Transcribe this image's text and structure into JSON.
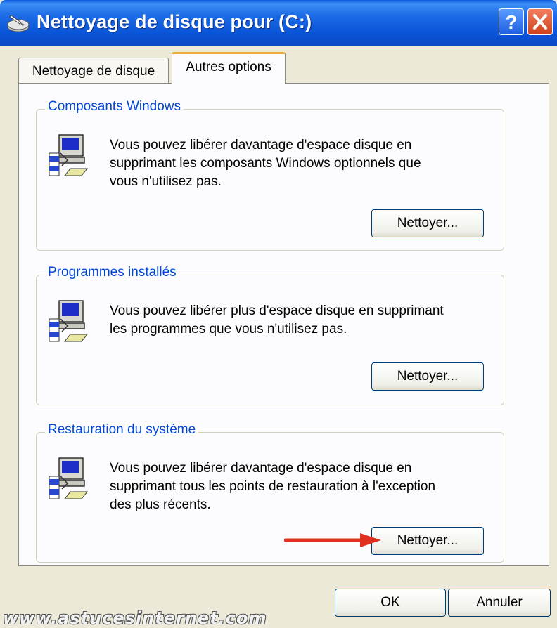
{
  "window": {
    "title": "Nettoyage de disque pour  (C:)",
    "help_label": "?",
    "colors": {
      "titlebar": "#0a55d8",
      "close": "#d0401a",
      "legend": "#0046d5",
      "arrow": "#e03020"
    }
  },
  "tabs": [
    {
      "label": "Nettoyage de disque",
      "active": false
    },
    {
      "label": "Autres options",
      "active": true
    }
  ],
  "groups": [
    {
      "title": "Composants Windows",
      "desc": [
        "Vous pouvez libérer davantage d'espace disque en",
        "supprimant les composants Windows optionnels que",
        "vous n'utilisez pas."
      ],
      "button": "Nettoyer...",
      "icon": "computer-setup-icon"
    },
    {
      "title": "Programmes installés",
      "desc": [
        "Vous pouvez libérer plus d'espace disque en supprimant",
        "les programmes que vous n'utilisez pas."
      ],
      "button": "Nettoyer...",
      "icon": "computer-setup-icon"
    },
    {
      "title": "Restauration du système",
      "desc": [
        "Vous pouvez libérer davantage d'espace disque en",
        "supprimant tous les points de restauration à l'exception",
        "des plus récents."
      ],
      "button": "Nettoyer...",
      "icon": "computer-setup-icon"
    }
  ],
  "footer": {
    "ok_label": "OK",
    "cancel_label": "Annuler"
  },
  "watermark": "www.astucesinternet.com"
}
